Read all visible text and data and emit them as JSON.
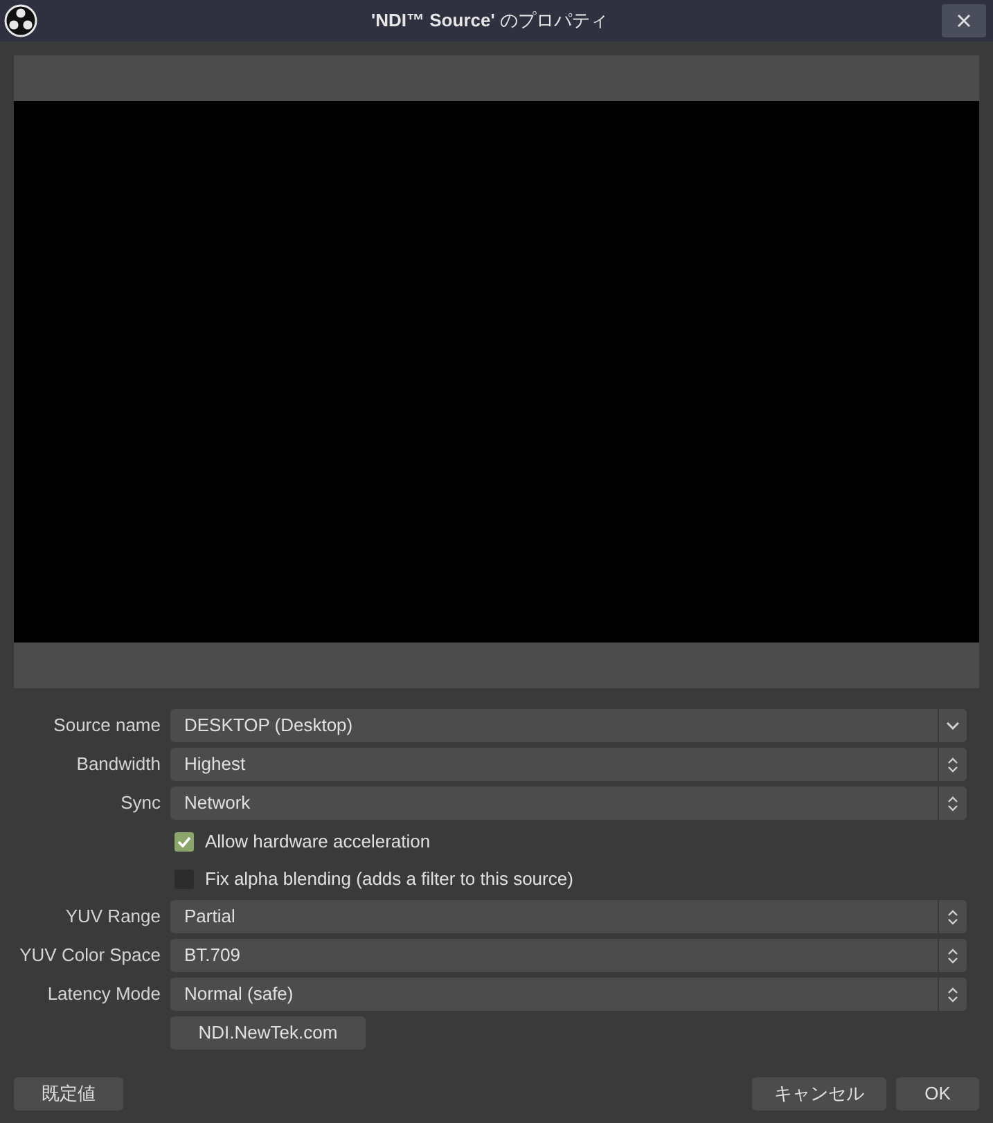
{
  "window": {
    "title": "**'NDI™ Source'** のプロパティ"
  },
  "properties": [
    {
      "kind": "combo",
      "label": "Source name",
      "value": "DESKTOP (Desktop)"
    },
    {
      "kind": "select",
      "label": "Bandwidth",
      "value": "Highest"
    },
    {
      "kind": "select",
      "label": "Sync",
      "value": "Network"
    },
    {
      "kind": "checkbox",
      "label": "Allow hardware acceleration",
      "checked": true
    },
    {
      "kind": "checkbox",
      "label": "Fix alpha blending (adds a filter to this source)",
      "checked": false
    },
    {
      "kind": "select",
      "label": "YUV Range",
      "value": "Partial"
    },
    {
      "kind": "select",
      "label": "YUV Color Space",
      "value": "BT.709"
    },
    {
      "kind": "select",
      "label": "Latency Mode",
      "value": "Normal (safe)"
    },
    {
      "kind": "button",
      "label": "NDI.NewTek.com"
    }
  ],
  "footer": {
    "defaults": "既定値",
    "cancel": "キャンセル",
    "ok": "OK"
  }
}
